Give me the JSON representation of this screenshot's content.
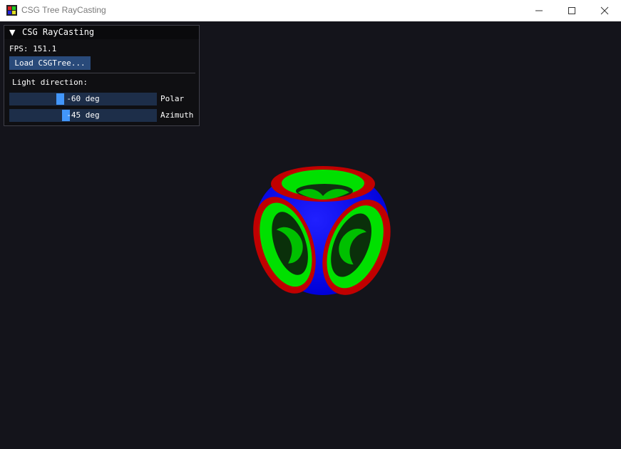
{
  "window": {
    "title": "CSG Tree RayCasting"
  },
  "panel": {
    "title": "CSG RayCasting",
    "fps_text": "FPS: 151.1",
    "load_button": "Load CSGTree...",
    "light_direction_label": "Light direction:",
    "sliders": [
      {
        "name": "Polar",
        "value_text": "-60 deg",
        "value": -60
      },
      {
        "name": "Azimuth",
        "value_text": "-45 deg",
        "value": -45
      }
    ]
  },
  "colors": {
    "viewport_background": "#14141b",
    "shape_blue": "#0000ff",
    "shape_red": "#c00000",
    "shape_green": "#00e000",
    "slider_grab": "#4296fa",
    "button_bg": "#294a7a"
  },
  "icons": {
    "minimize": "minimize-icon",
    "maximize": "maximize-icon",
    "close": "close-icon",
    "collapse": "triangle-down-icon"
  }
}
